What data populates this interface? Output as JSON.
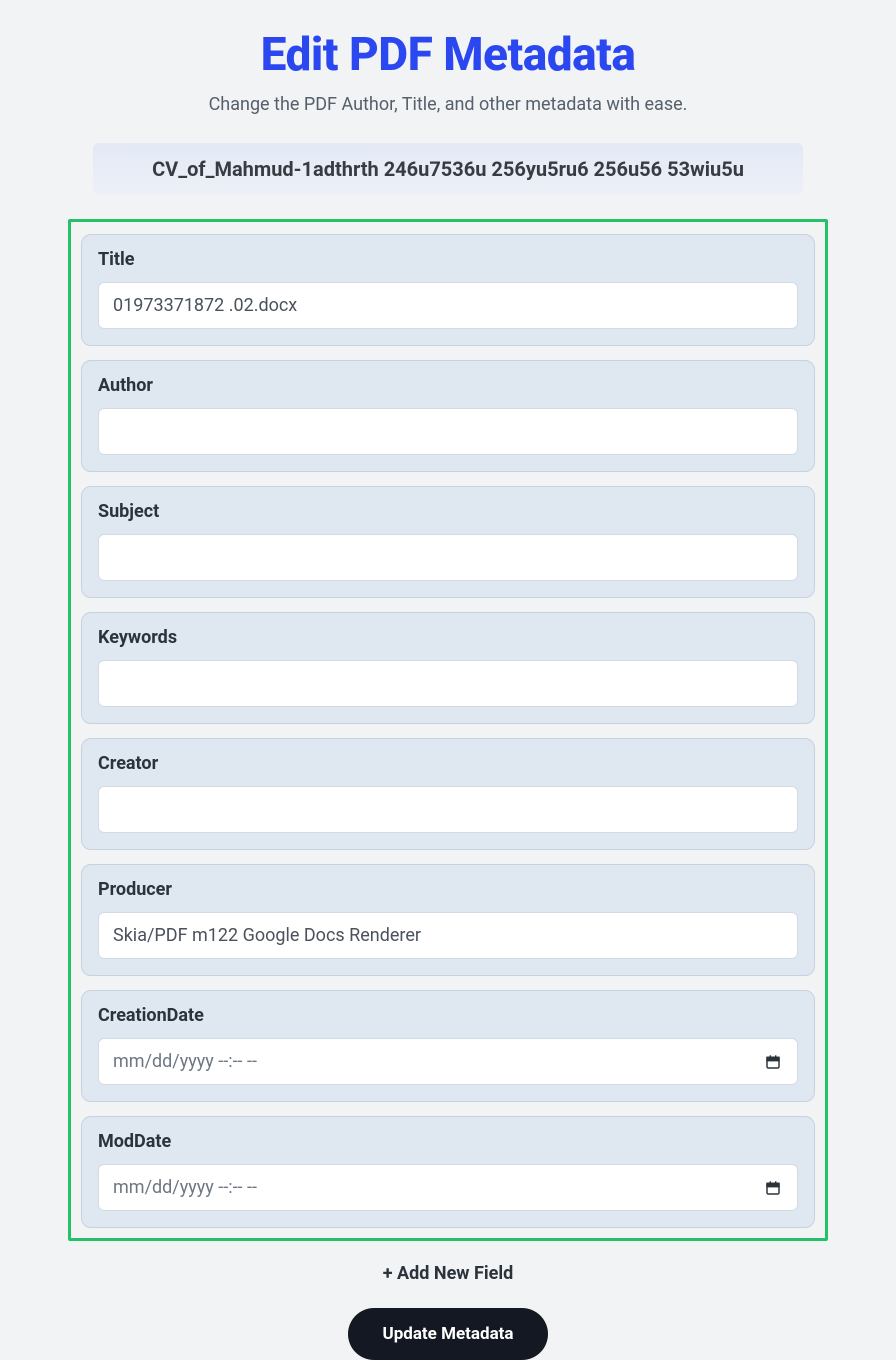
{
  "header": {
    "title": "Edit PDF Metadata",
    "subtitle": "Change the PDF Author, Title, and other metadata with ease."
  },
  "filename": "CV_of_Mahmud-1adthrth 246u7536u 256yu5ru6 256u56 53wiu5u",
  "fields": {
    "title": {
      "label": "Title",
      "value": "01973371872 .02.docx"
    },
    "author": {
      "label": "Author",
      "value": ""
    },
    "subject": {
      "label": "Subject",
      "value": ""
    },
    "keywords": {
      "label": "Keywords",
      "value": ""
    },
    "creator": {
      "label": "Creator",
      "value": ""
    },
    "producer": {
      "label": "Producer",
      "value": "Skia/PDF m122 Google Docs Renderer"
    },
    "creationDate": {
      "label": "CreationDate",
      "placeholder": "mm/dd/yyyy --:-- --"
    },
    "modDate": {
      "label": "ModDate",
      "placeholder": "mm/dd/yyyy --:-- --"
    }
  },
  "actions": {
    "addField": "+ Add New Field",
    "update": "Update Metadata"
  }
}
